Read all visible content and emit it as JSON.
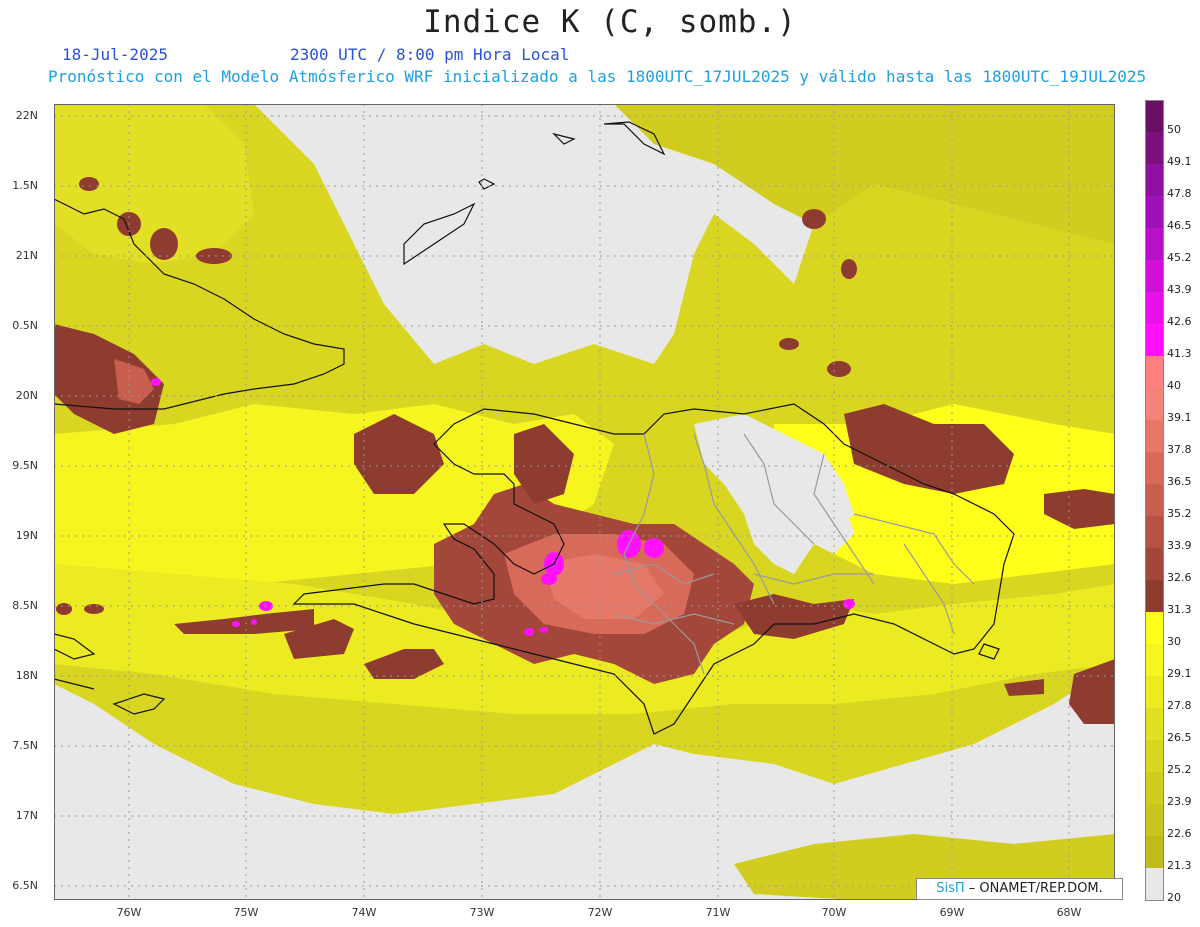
{
  "header": {
    "title": "Indice K (C, somb.)",
    "date": "18-Jul-2025",
    "time": "2300 UTC / 8:00 pm Hora Local",
    "description": "Pronóstico con el Modelo Atmósferico WRF inicializado a las 1800UTC_17JUL2025 y válido hasta las  1800UTC_19JUL2025"
  },
  "axes": {
    "lat_labels": [
      "22N",
      "1.5N",
      "21N",
      "0.5N",
      "20N",
      "9.5N",
      "19N",
      "8.5N",
      "18N",
      "7.5N",
      "17N",
      "6.5N"
    ],
    "lon_labels": [
      "76W",
      "75W",
      "74W",
      "73W",
      "72W",
      "71W",
      "70W",
      "69W",
      "68W"
    ]
  },
  "colorbar": {
    "levels": [
      {
        "label": "50",
        "color": "#6a0f66"
      },
      {
        "label": "49.1",
        "color": "#7e0f7e"
      },
      {
        "label": "47.8",
        "color": "#8f10a0"
      },
      {
        "label": "46.5",
        "color": "#a010b8"
      },
      {
        "label": "45.2",
        "color": "#b810c8"
      },
      {
        "label": "43.9",
        "color": "#d010d8"
      },
      {
        "label": "42.6",
        "color": "#e810e8"
      },
      {
        "label": "41.3",
        "color": "#ff10ff"
      },
      {
        "label": "40",
        "color": "#ff8080"
      },
      {
        "label": "39.1",
        "color": "#f28478"
      },
      {
        "label": "37.8",
        "color": "#e57868"
      },
      {
        "label": "36.5",
        "color": "#d86a5a"
      },
      {
        "label": "35.2",
        "color": "#c85e4e"
      },
      {
        "label": "33.9",
        "color": "#b55244"
      },
      {
        "label": "32.6",
        "color": "#a3473a"
      },
      {
        "label": "31.3",
        "color": "#8f3c30"
      },
      {
        "label": "30",
        "color": "#ffff1a"
      },
      {
        "label": "29.1",
        "color": "#f7f520"
      },
      {
        "label": "27.8",
        "color": "#eceb22"
      },
      {
        "label": "26.5",
        "color": "#e2e024"
      },
      {
        "label": "25.2",
        "color": "#d9d622"
      },
      {
        "label": "23.9",
        "color": "#d1cd20"
      },
      {
        "label": "22.6",
        "color": "#c9c51c"
      },
      {
        "label": "21.3",
        "color": "#c0bb18"
      },
      {
        "label": "20",
        "color": "#e8e8e8"
      }
    ]
  },
  "credit": {
    "sis": "SisΠ",
    "rest": " – ONAMET/REP.DOM."
  },
  "colors": {
    "no_data": "#e8e8e8",
    "coast": "#111111",
    "border": "#9a9a9a"
  }
}
